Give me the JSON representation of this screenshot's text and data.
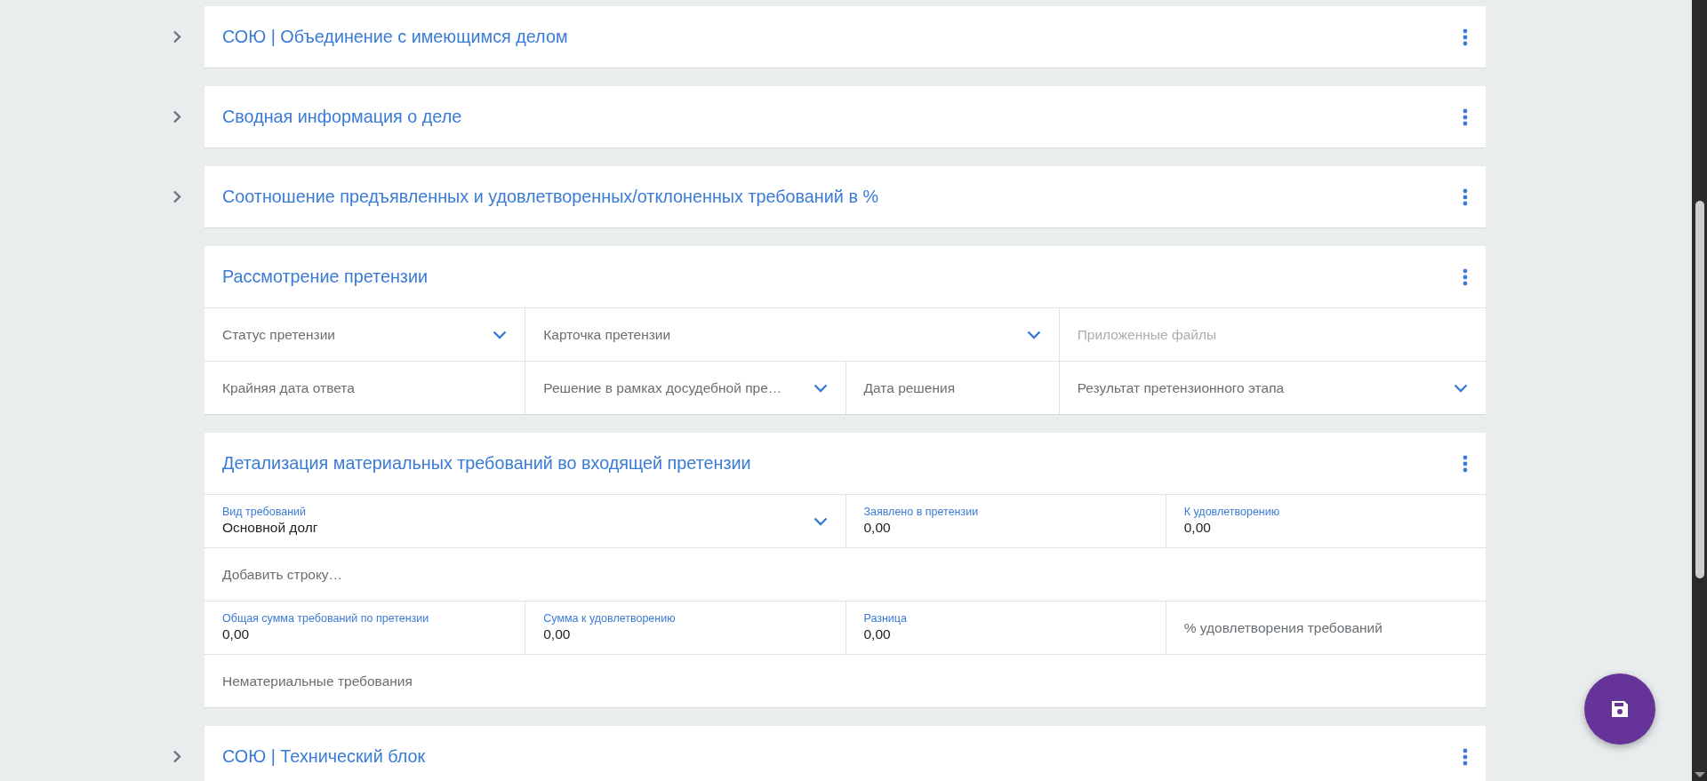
{
  "sections": [
    {
      "title": "СОЮ | Объединение с имеющимся делом",
      "expanded": false
    },
    {
      "title": "Сводная информация о деле",
      "expanded": false
    },
    {
      "title": "Соотношение предъявленных и удовлетворенных/отклоненных требований в %",
      "expanded": false
    },
    {
      "title": "Рассмотрение претензии",
      "expanded": true,
      "rows": [
        {
          "fields": [
            {
              "label": "Статус претензии",
              "dropdown": true,
              "disabled": false
            },
            {
              "label": "Карточка претензии",
              "dropdown": true,
              "disabled": false
            },
            {
              "label": "Приложенные файлы",
              "dropdown": false,
              "disabled": true
            }
          ]
        },
        {
          "fields": [
            {
              "label": "Крайняя дата ответа",
              "dropdown": false,
              "disabled": false
            },
            {
              "label": "Решение в рамках досудебной пре…",
              "dropdown": true,
              "disabled": false
            },
            {
              "label": "Дата решения",
              "dropdown": false,
              "disabled": false
            },
            {
              "label": "Результат претензионного этапа",
              "dropdown": true,
              "disabled": false
            }
          ]
        }
      ]
    },
    {
      "title": "Детализация материальных требований во входящей претензии",
      "expanded": true,
      "rows": [
        {
          "fields": [
            {
              "label": "Вид требований",
              "value": "Основной долг",
              "dropdown": true,
              "disabled": false
            },
            {
              "label": "Заявлено в претензии",
              "value": "0,00",
              "dropdown": false,
              "disabled": false
            },
            {
              "label": "К удовлетворению",
              "value": "0,00",
              "dropdown": false,
              "disabled": false
            }
          ]
        },
        {
          "fields": [
            {
              "label": "Добавить строку…",
              "dropdown": false,
              "disabled": false
            }
          ]
        },
        {
          "fields": [
            {
              "label": "Общая сумма требований по претензии",
              "value": "0,00",
              "dropdown": false,
              "disabled": false
            },
            {
              "label": "Сумма к удовлетворению",
              "value": "0,00",
              "dropdown": false,
              "disabled": false
            },
            {
              "label": "Разница",
              "value": "0,00",
              "dropdown": false,
              "disabled": false
            },
            {
              "label": "% удовлетворения требований",
              "dropdown": false,
              "disabled": false
            }
          ]
        },
        {
          "fields": [
            {
              "label": "Нематериальные требования",
              "dropdown": false,
              "disabled": false
            }
          ]
        }
      ]
    },
    {
      "title": "СОЮ | Технический блок",
      "expanded": false
    }
  ]
}
